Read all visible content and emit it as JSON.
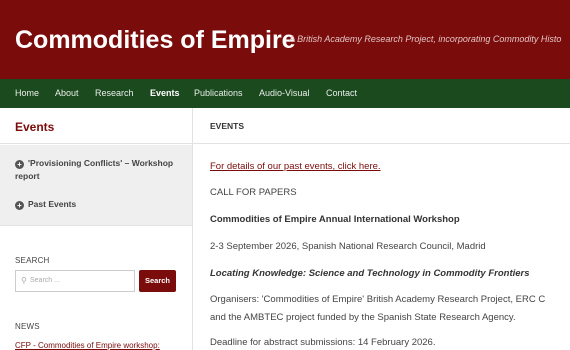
{
  "header": {
    "title": "Commodities of Empire",
    "tagline": "A British Academy Research Project, incorporating Commodity Histo"
  },
  "nav": {
    "items": [
      "Home",
      "About",
      "Research",
      "Events",
      "Publications",
      "Audio-Visual",
      "Contact"
    ],
    "active": "Events"
  },
  "sidebar": {
    "title": "Events",
    "links": [
      {
        "icon": "plus-circle-icon",
        "line1": "'Provisioning Conflicts' – Workshop",
        "line2": "report"
      },
      {
        "icon": "plus-circle-icon",
        "line1": "Past Events",
        "line2": ""
      }
    ],
    "search": {
      "label": "SEARCH",
      "placeholder": "Search ...",
      "button": "Search"
    },
    "news": {
      "label": "NEWS",
      "link": "CFP - Commodities of Empire workshop:"
    }
  },
  "main": {
    "heading": "EVENTS",
    "past_link": "For details of our past events, click here.",
    "cfp": "CALL FOR PAPERS",
    "workshop_title": "Commodities of Empire Annual International Workshop",
    "date_prefix": "2-3 September 2026",
    "date_suffix": ", Spanish National Research Council, Madrid",
    "theme": "Locating Knowledge: Science and Technology in Commodity Frontiers",
    "organisers_1": "Organisers: 'Commodities of Empire' British Academy Research Project, ERC C",
    "organisers_2": "and the AMBTEC project funded by the Spanish State Research Agency.",
    "deadline": "Deadline for abstract submissions: 14 February 2026."
  }
}
